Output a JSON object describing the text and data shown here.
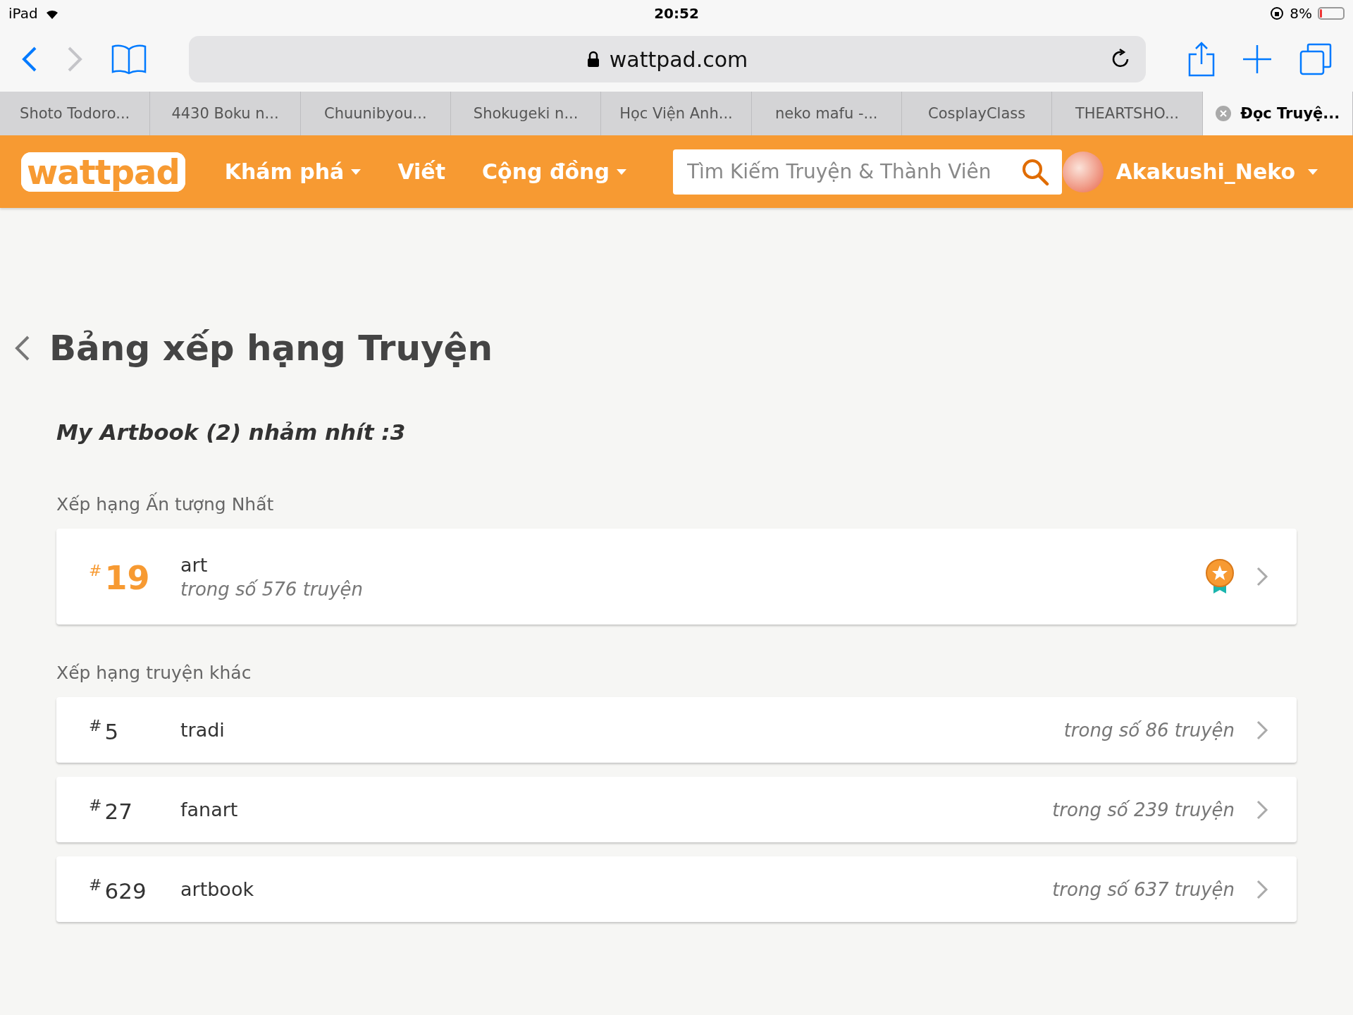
{
  "status_bar": {
    "device": "iPad",
    "time": "20:52",
    "battery": "8%"
  },
  "browser": {
    "url": "wattpad.com"
  },
  "tabs": [
    {
      "label": "Shoto Todoro...",
      "selected": false
    },
    {
      "label": "4430 Boku n...",
      "selected": false
    },
    {
      "label": "Chuunibyou...",
      "selected": false
    },
    {
      "label": "Shokugeki n...",
      "selected": false
    },
    {
      "label": "Học Viện Anh...",
      "selected": false
    },
    {
      "label": "neko mafu -...",
      "selected": false
    },
    {
      "label": "CosplayClass",
      "selected": false
    },
    {
      "label": "THEARTSHO...",
      "selected": false
    },
    {
      "label": "Đọc Truyệ...",
      "selected": true
    }
  ],
  "nav": {
    "logo": "wattpad",
    "items": [
      {
        "label": "Khám phá",
        "dropdown": true
      },
      {
        "label": "Viết",
        "dropdown": false
      },
      {
        "label": "Cộng đồng",
        "dropdown": true
      }
    ],
    "search": {
      "placeholder": "Tìm Kiếm Truyện & Thành Viên"
    },
    "user": {
      "name": "Akakushi_Neko"
    }
  },
  "page": {
    "title": "Bảng xếp hạng Truyện",
    "story_title": "My Artbook (2) nhảm nhít :3",
    "sections": [
      {
        "heading": "Xếp hạng Ấn tượng Nhất",
        "rankings": [
          {
            "kind": "featured",
            "hash": "#",
            "rank": "19",
            "tag": "art",
            "total": "trong số 576 truyện"
          }
        ]
      },
      {
        "heading": "Xếp hạng truyện khác",
        "rankings": [
          {
            "kind": "plain",
            "hash": "#",
            "rank": "5",
            "tag": "tradi",
            "total": "trong số 86 truyện"
          },
          {
            "kind": "plain",
            "hash": "#",
            "rank": "27",
            "tag": "fanart",
            "total": "trong số 239 truyện"
          },
          {
            "kind": "plain",
            "hash": "#",
            "rank": "629",
            "tag": "artbook",
            "total": "trong số 637 truyện"
          }
        ]
      }
    ]
  }
}
